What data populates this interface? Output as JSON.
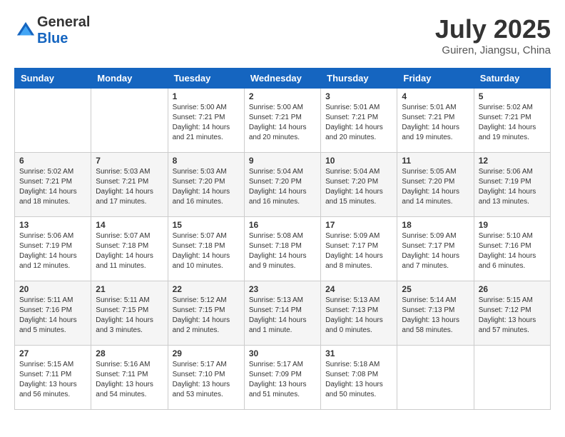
{
  "header": {
    "logo_general": "General",
    "logo_blue": "Blue",
    "month": "July 2025",
    "location": "Guiren, Jiangsu, China"
  },
  "weekdays": [
    "Sunday",
    "Monday",
    "Tuesday",
    "Wednesday",
    "Thursday",
    "Friday",
    "Saturday"
  ],
  "weeks": [
    [
      {
        "day": "",
        "content": ""
      },
      {
        "day": "",
        "content": ""
      },
      {
        "day": "1",
        "content": "Sunrise: 5:00 AM\nSunset: 7:21 PM\nDaylight: 14 hours\nand 21 minutes."
      },
      {
        "day": "2",
        "content": "Sunrise: 5:00 AM\nSunset: 7:21 PM\nDaylight: 14 hours\nand 20 minutes."
      },
      {
        "day": "3",
        "content": "Sunrise: 5:01 AM\nSunset: 7:21 PM\nDaylight: 14 hours\nand 20 minutes."
      },
      {
        "day": "4",
        "content": "Sunrise: 5:01 AM\nSunset: 7:21 PM\nDaylight: 14 hours\nand 19 minutes."
      },
      {
        "day": "5",
        "content": "Sunrise: 5:02 AM\nSunset: 7:21 PM\nDaylight: 14 hours\nand 19 minutes."
      }
    ],
    [
      {
        "day": "6",
        "content": "Sunrise: 5:02 AM\nSunset: 7:21 PM\nDaylight: 14 hours\nand 18 minutes."
      },
      {
        "day": "7",
        "content": "Sunrise: 5:03 AM\nSunset: 7:21 PM\nDaylight: 14 hours\nand 17 minutes."
      },
      {
        "day": "8",
        "content": "Sunrise: 5:03 AM\nSunset: 7:20 PM\nDaylight: 14 hours\nand 16 minutes."
      },
      {
        "day": "9",
        "content": "Sunrise: 5:04 AM\nSunset: 7:20 PM\nDaylight: 14 hours\nand 16 minutes."
      },
      {
        "day": "10",
        "content": "Sunrise: 5:04 AM\nSunset: 7:20 PM\nDaylight: 14 hours\nand 15 minutes."
      },
      {
        "day": "11",
        "content": "Sunrise: 5:05 AM\nSunset: 7:20 PM\nDaylight: 14 hours\nand 14 minutes."
      },
      {
        "day": "12",
        "content": "Sunrise: 5:06 AM\nSunset: 7:19 PM\nDaylight: 14 hours\nand 13 minutes."
      }
    ],
    [
      {
        "day": "13",
        "content": "Sunrise: 5:06 AM\nSunset: 7:19 PM\nDaylight: 14 hours\nand 12 minutes."
      },
      {
        "day": "14",
        "content": "Sunrise: 5:07 AM\nSunset: 7:18 PM\nDaylight: 14 hours\nand 11 minutes."
      },
      {
        "day": "15",
        "content": "Sunrise: 5:07 AM\nSunset: 7:18 PM\nDaylight: 14 hours\nand 10 minutes."
      },
      {
        "day": "16",
        "content": "Sunrise: 5:08 AM\nSunset: 7:18 PM\nDaylight: 14 hours\nand 9 minutes."
      },
      {
        "day": "17",
        "content": "Sunrise: 5:09 AM\nSunset: 7:17 PM\nDaylight: 14 hours\nand 8 minutes."
      },
      {
        "day": "18",
        "content": "Sunrise: 5:09 AM\nSunset: 7:17 PM\nDaylight: 14 hours\nand 7 minutes."
      },
      {
        "day": "19",
        "content": "Sunrise: 5:10 AM\nSunset: 7:16 PM\nDaylight: 14 hours\nand 6 minutes."
      }
    ],
    [
      {
        "day": "20",
        "content": "Sunrise: 5:11 AM\nSunset: 7:16 PM\nDaylight: 14 hours\nand 5 minutes."
      },
      {
        "day": "21",
        "content": "Sunrise: 5:11 AM\nSunset: 7:15 PM\nDaylight: 14 hours\nand 3 minutes."
      },
      {
        "day": "22",
        "content": "Sunrise: 5:12 AM\nSunset: 7:15 PM\nDaylight: 14 hours\nand 2 minutes."
      },
      {
        "day": "23",
        "content": "Sunrise: 5:13 AM\nSunset: 7:14 PM\nDaylight: 14 hours\nand 1 minute."
      },
      {
        "day": "24",
        "content": "Sunrise: 5:13 AM\nSunset: 7:13 PM\nDaylight: 14 hours\nand 0 minutes."
      },
      {
        "day": "25",
        "content": "Sunrise: 5:14 AM\nSunset: 7:13 PM\nDaylight: 13 hours\nand 58 minutes."
      },
      {
        "day": "26",
        "content": "Sunrise: 5:15 AM\nSunset: 7:12 PM\nDaylight: 13 hours\nand 57 minutes."
      }
    ],
    [
      {
        "day": "27",
        "content": "Sunrise: 5:15 AM\nSunset: 7:11 PM\nDaylight: 13 hours\nand 56 minutes."
      },
      {
        "day": "28",
        "content": "Sunrise: 5:16 AM\nSunset: 7:11 PM\nDaylight: 13 hours\nand 54 minutes."
      },
      {
        "day": "29",
        "content": "Sunrise: 5:17 AM\nSunset: 7:10 PM\nDaylight: 13 hours\nand 53 minutes."
      },
      {
        "day": "30",
        "content": "Sunrise: 5:17 AM\nSunset: 7:09 PM\nDaylight: 13 hours\nand 51 minutes."
      },
      {
        "day": "31",
        "content": "Sunrise: 5:18 AM\nSunset: 7:08 PM\nDaylight: 13 hours\nand 50 minutes."
      },
      {
        "day": "",
        "content": ""
      },
      {
        "day": "",
        "content": ""
      }
    ]
  ]
}
